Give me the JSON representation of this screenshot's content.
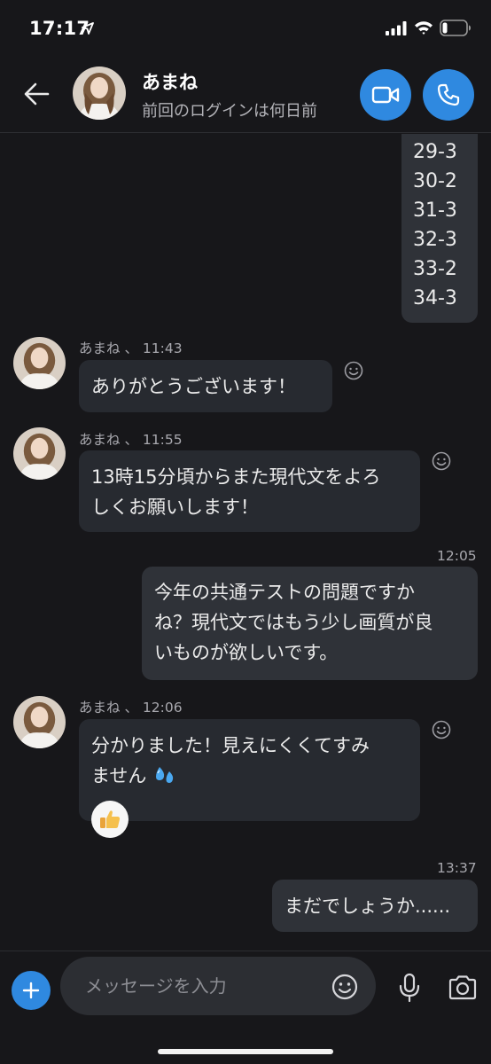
{
  "status_bar": {
    "time": "17:17"
  },
  "header": {
    "contact_name": "あまね",
    "contact_status": "前回のログインは何日前"
  },
  "messages": {
    "codes": [
      "29-3",
      "30-2",
      "31-3",
      "32-3",
      "33-2",
      "34-3"
    ],
    "m1": {
      "sender": "あまね",
      "time": "11:43",
      "text": "ありがとうございます！"
    },
    "m2": {
      "sender": "あまね",
      "time": "11:55",
      "line1": "13時15分頃からまた現代文をよろ",
      "line2": "しくお願いします！"
    },
    "m3": {
      "time": "12:05",
      "line1": "今年の共通テストの問題ですか",
      "line2": "ね？現代文ではもう少し画質が良",
      "line3": "いものが欲しいです。"
    },
    "m4": {
      "sender": "あまね",
      "time": "12:06",
      "line1": "分かりました！見えにくくてすみ",
      "line2": "ません",
      "reaction": "thumbs-up"
    },
    "m5": {
      "time": "13:37",
      "text": "まだでしょうか......"
    },
    "separator": "、"
  },
  "input": {
    "placeholder": "メッセージを入力",
    "value": ""
  },
  "colors": {
    "accent": "#2f89e0",
    "background": "#17171a",
    "bubble": "#272a30"
  }
}
